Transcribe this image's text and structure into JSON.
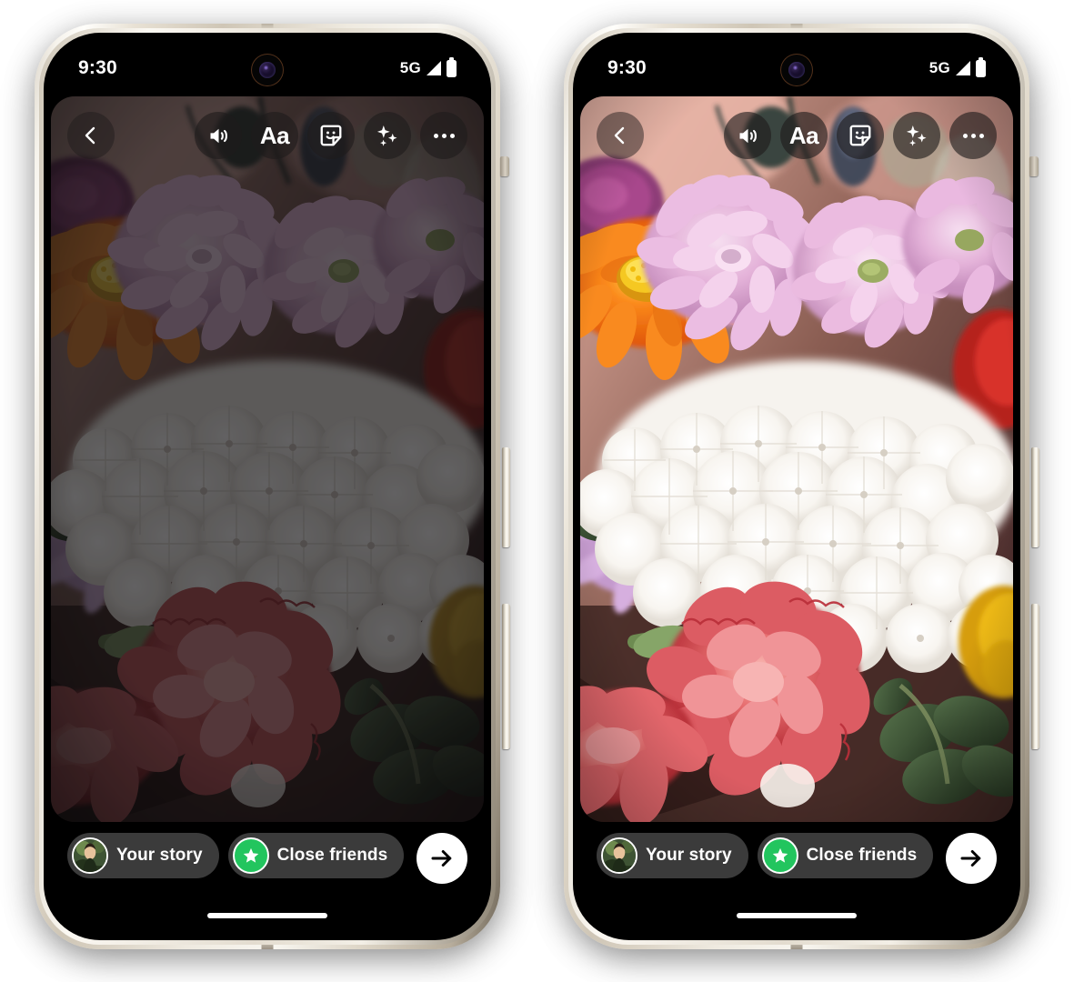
{
  "screenshot": {
    "description": "Two side-by-side smartphone mockups showing an Instagram-style story editor with a flower bouquet photo; the left device screen is dimmed and the right device screen is at full brightness."
  },
  "devices": [
    {
      "id": "left",
      "variant": "dimmed",
      "statusbar": {
        "time": "9:30",
        "network": "5G",
        "signal_icon": "signal-triangle-icon",
        "battery_icon": "battery-full-icon"
      },
      "camera_icon": "front-camera-punchhole-icon"
    },
    {
      "id": "right",
      "variant": "bright",
      "statusbar": {
        "time": "9:30",
        "network": "5G",
        "signal_icon": "signal-triangle-icon",
        "battery_icon": "battery-full-icon"
      },
      "camera_icon": "front-camera-punchhole-icon"
    }
  ],
  "toolbar": {
    "back": {
      "icon": "chevron-left-icon",
      "label": "Back"
    },
    "items": [
      {
        "icon": "volume-sound-icon",
        "label": "Sound"
      },
      {
        "icon": "text-aa-icon",
        "label": "Aa"
      },
      {
        "icon": "sticker-icon",
        "label": "Sticker"
      },
      {
        "icon": "sparkles-effects-icon",
        "label": "Effects"
      },
      {
        "icon": "more-ellipsis-icon",
        "label": "More"
      }
    ],
    "aa_label": "Aa"
  },
  "bottombar": {
    "your_story": {
      "label": "Your story",
      "avatar": "user-avatar"
    },
    "close_friends": {
      "label": "Close friends",
      "badge_icon": "green-star-icon",
      "badge_color": "#22c55e"
    },
    "send": {
      "icon": "arrow-right-icon",
      "label": "Share"
    },
    "home_indicator": "home-indicator-bar"
  },
  "colors": {
    "pill_background": "#3b3b3b",
    "toolbar_button": "rgba(32,28,28,0.48)",
    "close_friends_green": "#22c55e",
    "send_button": "#ffffff",
    "screen_background": "#000000",
    "frame_metal": "#e8e1d4"
  },
  "photo": {
    "subject": "flower bouquet",
    "elements": [
      "pink chrysanthemums",
      "orange zinnia",
      "white hydrangeas",
      "red-pink carnations",
      "yellow flower",
      "green leaves",
      "blue thistle"
    ]
  }
}
